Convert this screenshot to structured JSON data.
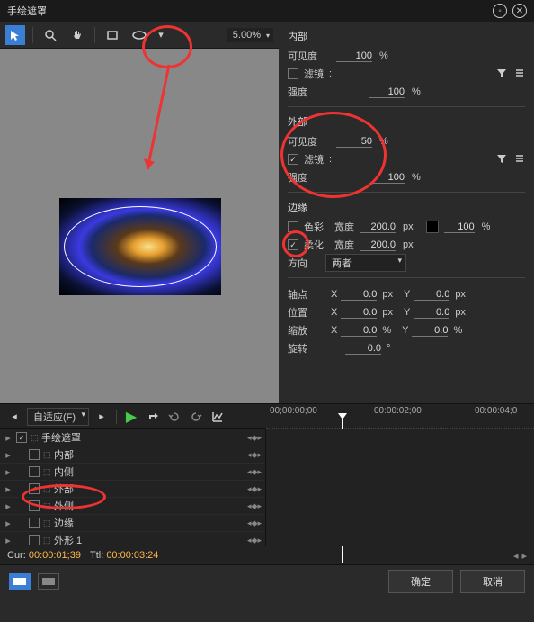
{
  "title": "手绘遮罩",
  "toolbar": {
    "zoom": "5.00%"
  },
  "sections": {
    "inner": {
      "header": "内部",
      "visibility_label": "可见度",
      "visibility": "100",
      "filter_label": "滤镜",
      "filter_sep": ":",
      "strength_label": "强度",
      "strength": "100"
    },
    "outer": {
      "header": "外部",
      "visibility_label": "可见度",
      "visibility": "50",
      "filter_label": "滤镜",
      "filter_sep": ":",
      "strength_label": "强度",
      "strength": "100"
    },
    "edge": {
      "header": "边缘",
      "color_label": "色彩",
      "width_label": "宽度",
      "color_width": "200.0",
      "color_opacity": "100",
      "soft_label": "柔化",
      "soft_width": "200.0",
      "dir_label": "方向",
      "dir_value": "两者"
    },
    "transform": {
      "pivot_label": "轴点",
      "pivot_x": "0.0",
      "pivot_y": "0.0",
      "pos_label": "位置",
      "pos_x": "0.0",
      "pos_y": "0.0",
      "scale_label": "缩放",
      "scale_x": "0.0",
      "scale_y": "0.0",
      "rot_label": "旋转",
      "rot": "0.0"
    }
  },
  "timeline": {
    "fit_label": "自适应(F)",
    "ruler": {
      "t0": "00;00:00;00",
      "t1": "00:00:02;00",
      "t2": "00:00:04;0"
    },
    "tracks": [
      {
        "name": "手绘遮罩",
        "checked": true,
        "indent": 0
      },
      {
        "name": "内部",
        "checked": false,
        "indent": 1
      },
      {
        "name": "内侧",
        "checked": false,
        "indent": 1
      },
      {
        "name": "外部",
        "checked": true,
        "indent": 1
      },
      {
        "name": "外侧",
        "checked": false,
        "indent": 1
      },
      {
        "name": "边缘",
        "checked": false,
        "indent": 1
      },
      {
        "name": "外形 1",
        "checked": false,
        "indent": 1
      }
    ],
    "cur_label": "Cur:",
    "cur": "00:00:01;39",
    "ttl_label": "Ttl:",
    "ttl": "00:00:03:24"
  },
  "footer": {
    "ok": "确定",
    "cancel": "取消"
  },
  "units": {
    "percent": "%",
    "px": "px",
    "deg": "°",
    "X": "X",
    "Y": "Y"
  }
}
